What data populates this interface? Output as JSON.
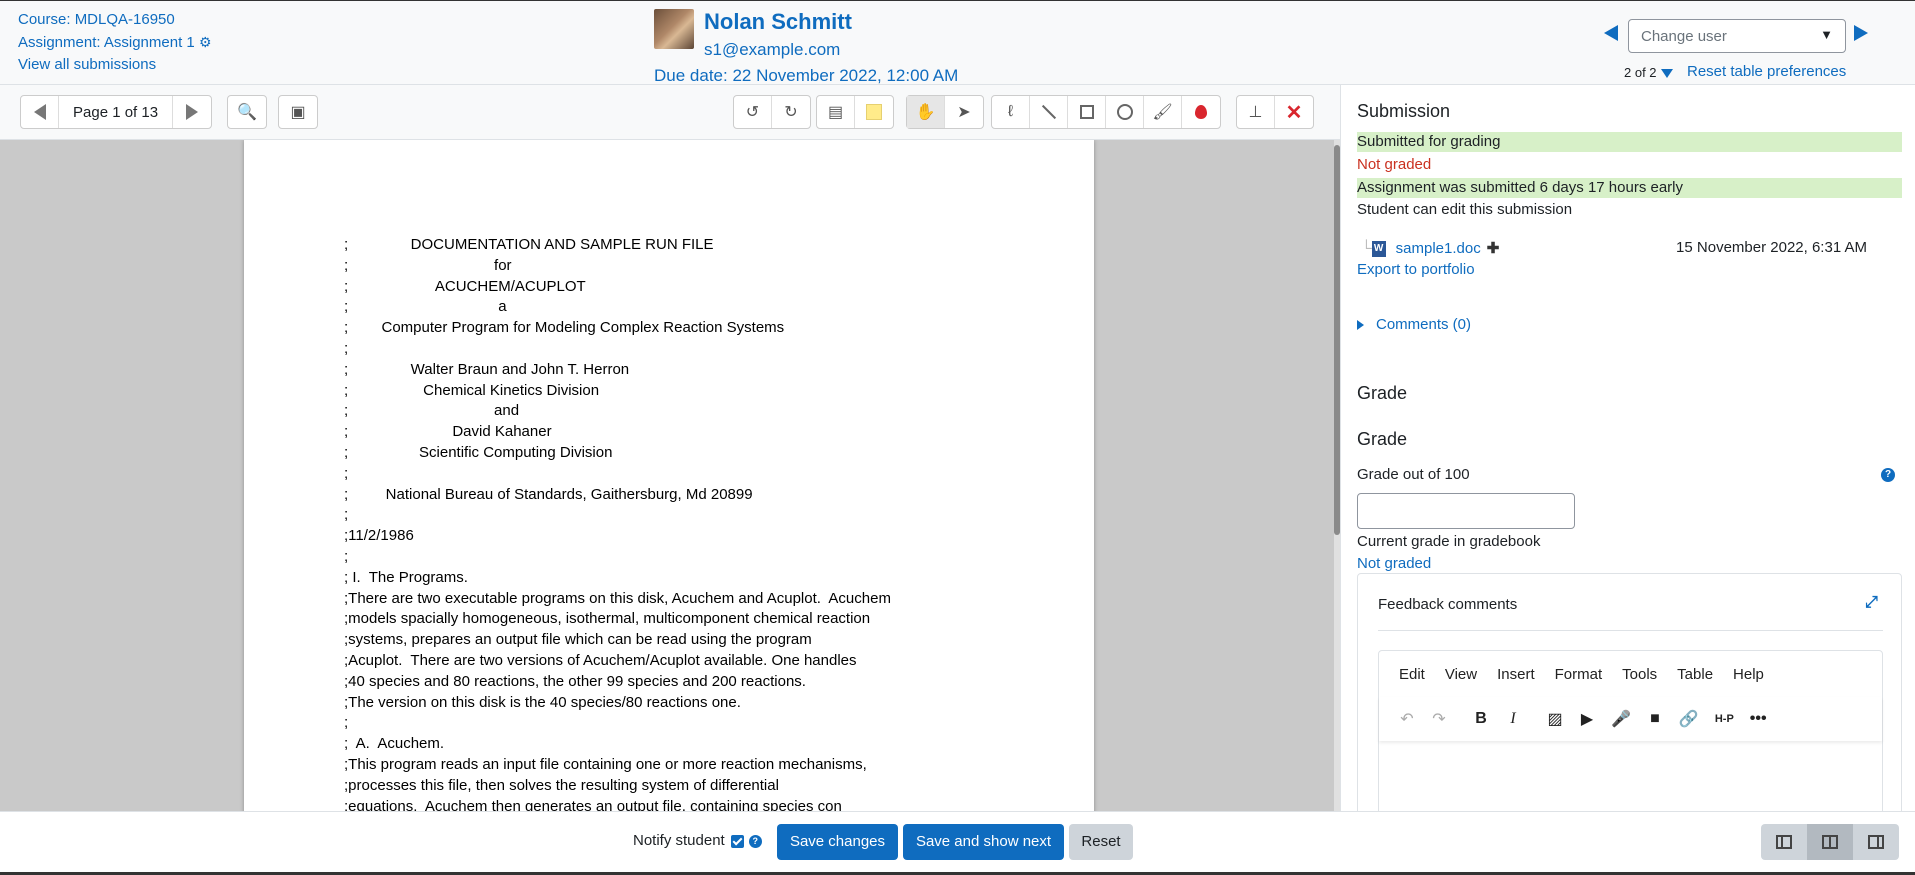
{
  "header": {
    "course_link": "Course: MDLQA-16950",
    "assignment_link": "Assignment: Assignment 1",
    "view_all": "View all submissions",
    "user_name": "Nolan Schmitt",
    "user_email": "s1@example.com",
    "due_date": "Due date: 22 November 2022, 12:00 AM",
    "change_user_placeholder": "Change user",
    "count": "2 of 2",
    "reset_prefs": "Reset table preferences"
  },
  "toolbar": {
    "page_label": "Page 1 of 13"
  },
  "document": {
    "lines": [
      ";               DOCUMENTATION AND SAMPLE RUN FILE",
      ";                                   for",
      ";                     ACUCHEM/ACUPLOT",
      ";                                    a",
      ";        Computer Program for Modeling Complex Reaction Systems",
      ";",
      ";               Walter Braun and John T. Herron",
      ";                  Chemical Kinetics Division",
      ";                                   and",
      ";                         David Kahaner",
      ";                 Scientific Computing Division",
      ";",
      ";         National Bureau of Standards, Gaithersburg, Md 20899",
      ";",
      ";11/2/1986",
      ";",
      "; I.  The Programs.",
      ";There are two executable programs on this disk, Acuchem and Acuplot.  Acuchem",
      ";models spacially homogeneous, isothermal, multicomponent chemical reaction",
      ";systems, prepares an output file which can be read using the program",
      ";Acuplot.  There are two versions of Acuchem/Acuplot available. One handles",
      ";40 species and 80 reactions, the other 99 species and 200 reactions.",
      ";The version on this disk is the 40 species/80 reactions one.",
      ";",
      ";  A.  Acuchem.",
      ";This program reads an input file containing one or more reaction mechanisms,",
      ";processes this file, then solves the resulting system of differential",
      ";equations.  Acuchem then generates an output file, containing species con"
    ]
  },
  "submission": {
    "title": "Submission",
    "status": "Submitted for grading",
    "grading_status": "Not graded",
    "timing": "Assignment was submitted 6 days 17 hours early",
    "edit_status": "Student can edit this submission",
    "file_name": "sample1.doc",
    "file_date": "15 November 2022, 6:31 AM",
    "export": "Export to portfolio",
    "comments": "Comments (0)"
  },
  "grade": {
    "section_title": "Grade",
    "subtitle": "Grade",
    "grade_out_of": "Grade out of 100",
    "current_grade_label": "Current grade in gradebook",
    "current_grade_value": "Not graded"
  },
  "feedback": {
    "title": "Feedback comments",
    "menu": [
      "Edit",
      "View",
      "Insert",
      "Format",
      "Tools",
      "Table",
      "Help"
    ]
  },
  "footer": {
    "notify_label": "Notify student",
    "save_changes": "Save changes",
    "save_and_next": "Save and show next",
    "reset": "Reset"
  },
  "colors": {
    "link": "#0f6cbf",
    "success_bg": "#d7f0c8",
    "danger": "#ca3120"
  }
}
